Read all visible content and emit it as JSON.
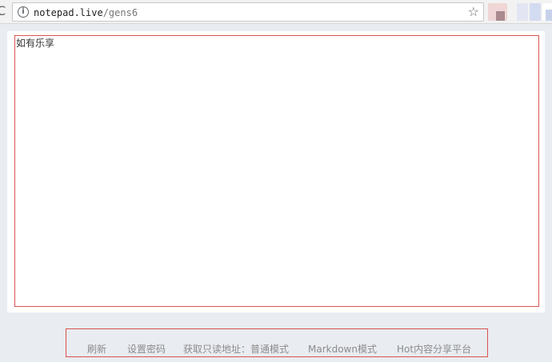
{
  "browser": {
    "reload_glyph": "C",
    "info_glyph": "i",
    "url_host": "notepad.live",
    "url_path": "/gens6",
    "star_glyph": "☆",
    "extensions": [
      "extension-icon-1",
      "extension-icon-2",
      "extension-icon-3",
      "extension-icon-4"
    ]
  },
  "editor": {
    "content": "如有乐享"
  },
  "footer": {
    "refresh": "刷新",
    "set_password": "设置密码",
    "readonly_link": "获取只读地址：普通模式",
    "markdown_mode": "Markdown模式",
    "hot_platform": "Hot内容分享平台"
  },
  "colors": {
    "highlight_border": "#d9534f",
    "page_background": "#e9ecf1",
    "footer_text": "#8b8b8b"
  }
}
